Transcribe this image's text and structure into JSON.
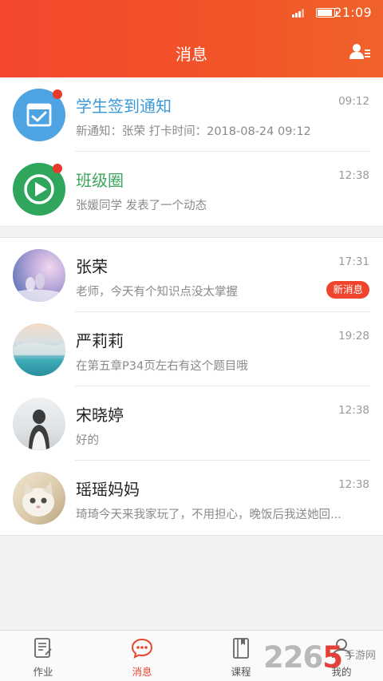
{
  "status_bar": {
    "time": "21:09"
  },
  "header": {
    "title": "消息"
  },
  "notifications": [
    {
      "name": "学生签到通知",
      "subtitle": "新通知：张荣  打卡时间：2018-08-24 09:12",
      "time": "09:12",
      "name_color": "#3a9ad9"
    },
    {
      "name": "班级圈",
      "subtitle": "张媛同学 发表了一个动态",
      "time": "12:38",
      "name_color": "#3aa45a"
    }
  ],
  "chats": [
    {
      "name": "张荣",
      "subtitle": "老师，今天有个知识点没太掌握",
      "time": "17:31",
      "badge": "新消息"
    },
    {
      "name": "严莉莉",
      "subtitle": "在第五章P34页左右有这个题目哦",
      "time": "19:28"
    },
    {
      "name": "宋晓婷",
      "subtitle": "好的",
      "time": "12:38"
    },
    {
      "name": "瑶瑶妈妈",
      "subtitle": "琦琦今天来我家玩了，不用担心，晚饭后我送她回...",
      "time": "12:38"
    }
  ],
  "tabs": [
    {
      "label": "作业",
      "icon": "homework-icon"
    },
    {
      "label": "消息",
      "icon": "message-icon",
      "active": true
    },
    {
      "label": "课程",
      "icon": "course-icon"
    },
    {
      "label": "我的",
      "icon": "profile-icon"
    }
  ],
  "watermark": {
    "number": "2265",
    "site": "手游网"
  },
  "colors": {
    "accent": "#f24a2c",
    "unread_dot": "#e83a2c"
  }
}
